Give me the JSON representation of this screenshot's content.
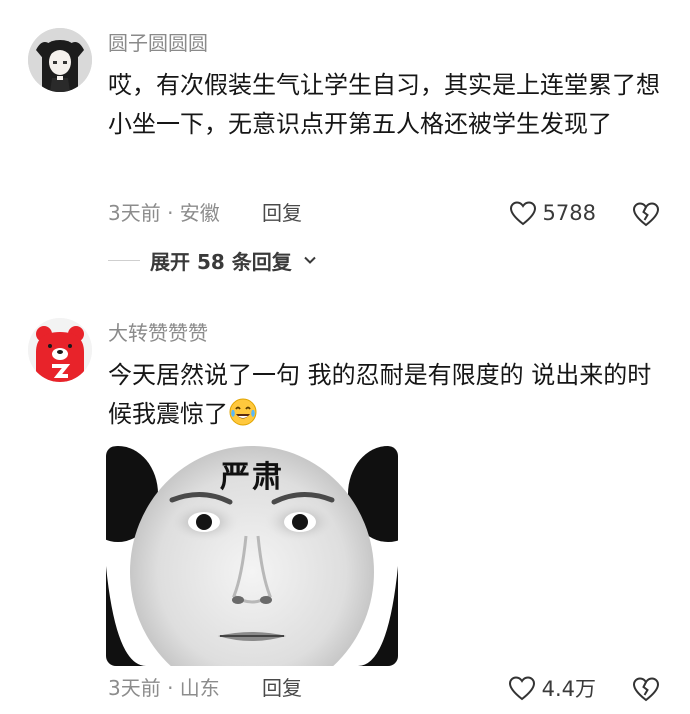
{
  "comments": [
    {
      "username": "圆子圆圆圆",
      "text": "哎，有次假装生气让学生自习，其实是上连堂累了想小坐一下，无意识点开第五人格还被学生发现了",
      "time_location": "3天前 · 安徽",
      "reply_label": "回复",
      "like_count": "5788",
      "expand_label": "展开 58 条回复",
      "avatar_icon": "anime-girl-avatar"
    },
    {
      "username": "大转赞赞赞",
      "text": "今天居然说了一句 我的忍耐是有限度的 说出来的时候我震惊了",
      "emoji_icon": "crying-laughing-emoji",
      "meme_caption": "严肃",
      "time_location": "3天前 · 山东",
      "reply_label": "回复",
      "like_count": "4.4万",
      "avatar_icon": "red-bear-avatar"
    }
  ],
  "colors": {
    "username": "#8a8a8a",
    "text": "#161616",
    "meta": "#8c8c8c",
    "bear_red": "#e8232a"
  }
}
